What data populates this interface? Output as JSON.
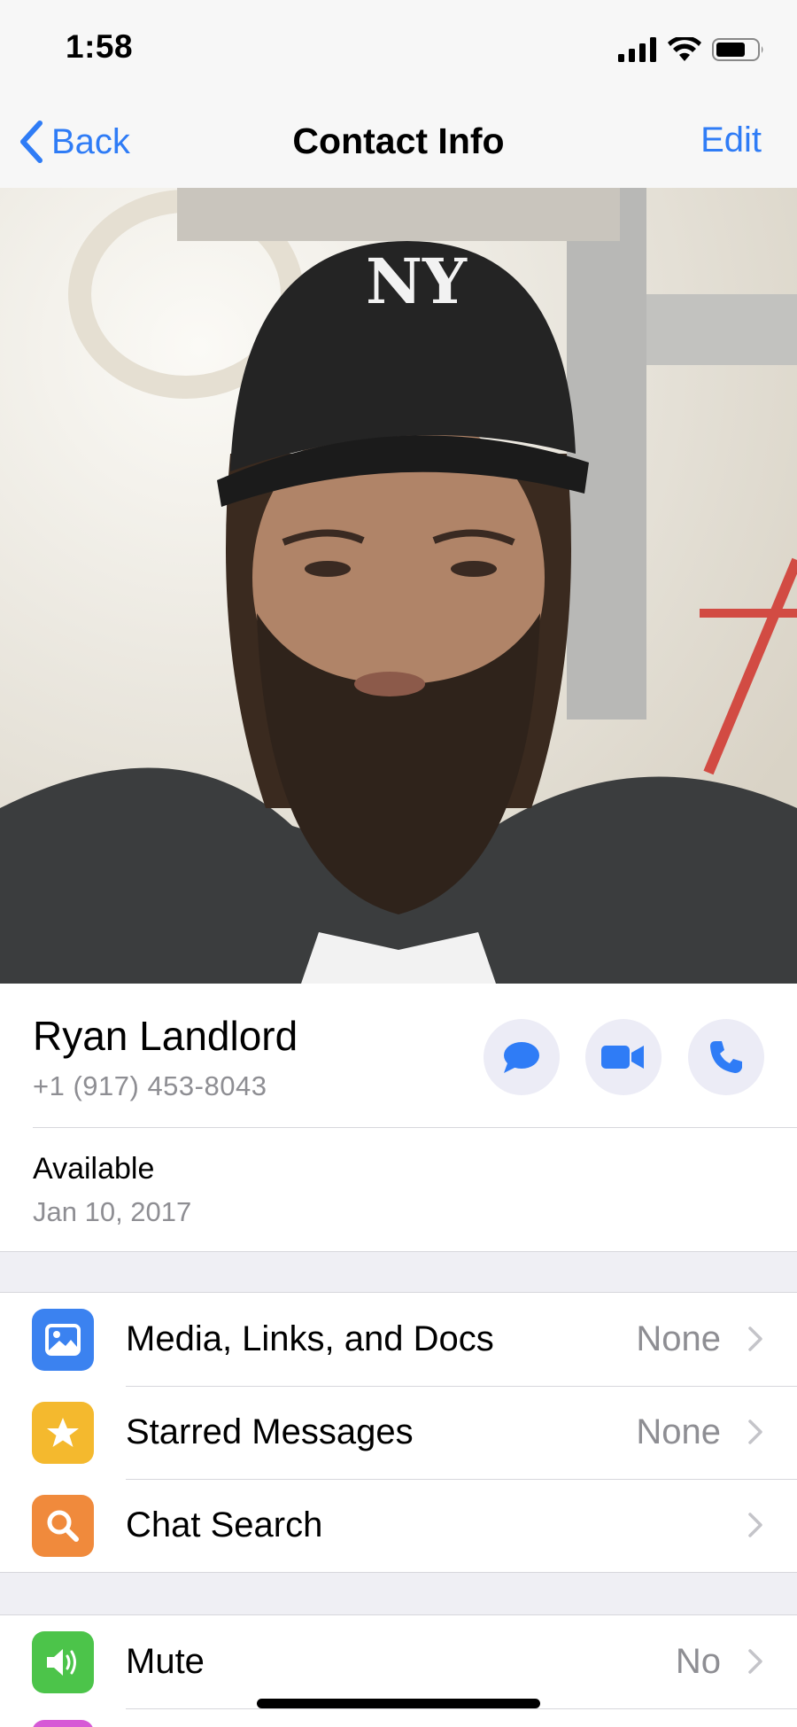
{
  "status_bar": {
    "time": "1:58",
    "icons": [
      "signal-icon",
      "wifi-icon",
      "battery-icon"
    ]
  },
  "nav": {
    "back_label": "Back",
    "title": "Contact Info",
    "edit_label": "Edit"
  },
  "contact": {
    "name": "Ryan Landlord",
    "phone": "+1 (917) 453-8043",
    "about": "Available",
    "about_date": "Jan 10, 2017",
    "actions": [
      "message-icon",
      "video-call-icon",
      "phone-call-icon"
    ]
  },
  "group1": [
    {
      "label": "Media, Links, and Docs",
      "value": "None",
      "icon": "photo-icon",
      "color": "#3b82f0"
    },
    {
      "label": "Starred Messages",
      "value": "None",
      "icon": "star-icon",
      "color": "#f4b92e"
    },
    {
      "label": "Chat Search",
      "value": "",
      "icon": "search-icon",
      "color": "#f08a3c"
    }
  ],
  "group2": [
    {
      "label": "Mute",
      "value": "No",
      "icon": "speaker-icon",
      "color": "#4cc44a"
    }
  ],
  "colors": {
    "accent": "#2f7cf6",
    "action_bg": "#ececf6",
    "background": "#efeff4"
  }
}
